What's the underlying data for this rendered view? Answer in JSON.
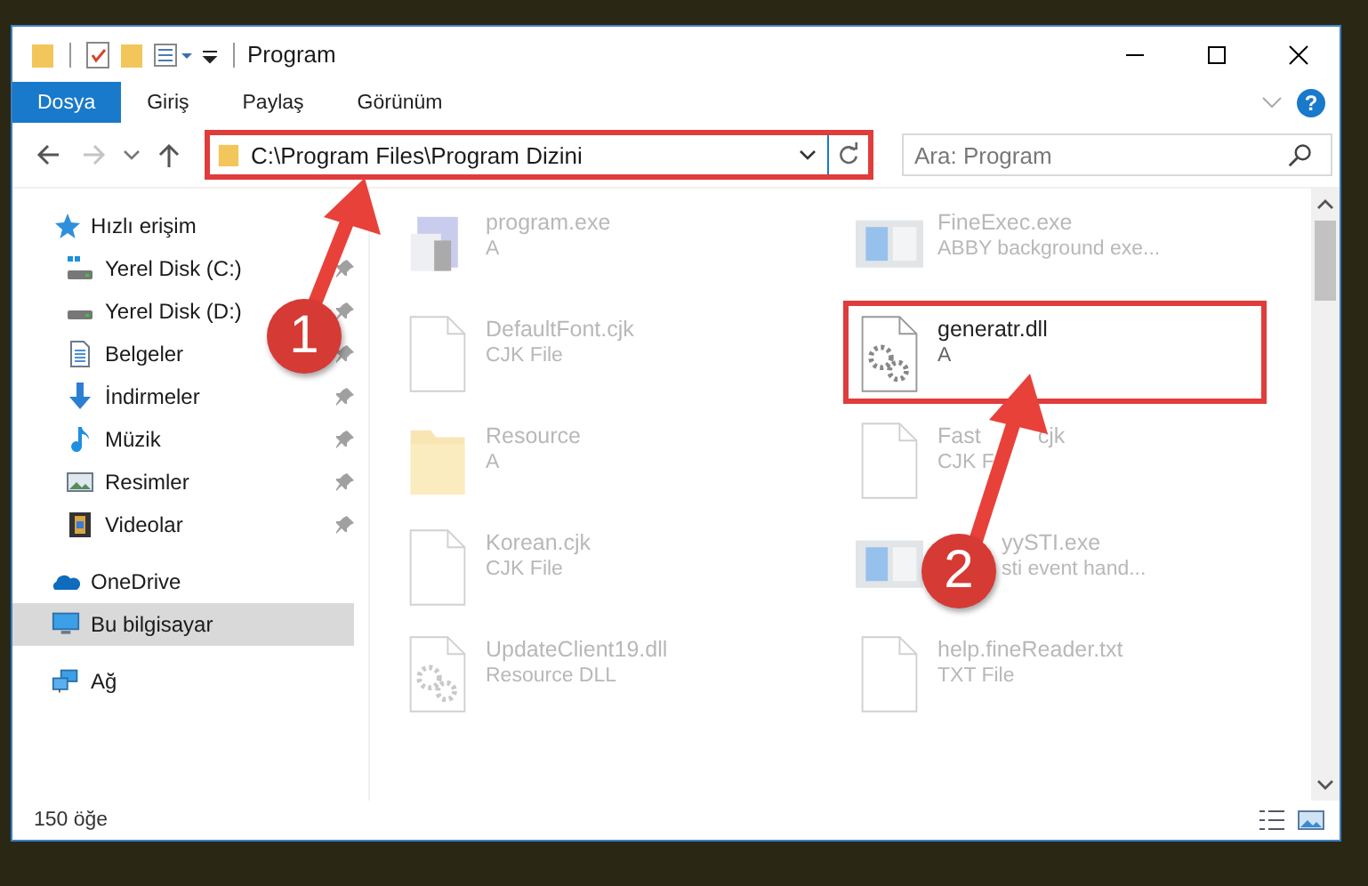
{
  "window": {
    "title": "Program",
    "help": "?"
  },
  "tabs": [
    {
      "label": "Dosya",
      "selected": true
    },
    {
      "label": "Giriş",
      "selected": false
    },
    {
      "label": "Paylaş",
      "selected": false
    },
    {
      "label": "Görünüm",
      "selected": false
    }
  ],
  "navigation": [
    {
      "kind": "back",
      "disabled": false
    },
    {
      "kind": "forward",
      "disabled": true
    }
  ],
  "address": {
    "value": "C:\\Program Files\\Program Dizini",
    "highlighted": true
  },
  "search": {
    "placeholder": "Ara: Program"
  },
  "sidebar": {
    "items": [
      {
        "label": "Hızlı erişim",
        "kind": "star",
        "selected": false,
        "children": [
          {
            "label": "Yerel Disk (C:)",
            "kind": "disk-c",
            "pinned": true,
            "selected": false
          },
          {
            "label": "Yerel Disk (D:)",
            "kind": "disk",
            "pinned": true,
            "selected": false
          },
          {
            "label": "Belgeler",
            "kind": "document",
            "pinned": true,
            "selected": false
          },
          {
            "label": "İndirmeler",
            "kind": "download",
            "pinned": true,
            "selected": false
          },
          {
            "label": "Müzik",
            "kind": "music",
            "pinned": true,
            "selected": false
          },
          {
            "label": "Resimler",
            "kind": "image",
            "pinned": true,
            "selected": false
          },
          {
            "label": "Videolar",
            "kind": "film",
            "pinned": true,
            "selected": false
          }
        ]
      },
      {
        "label": "OneDrive",
        "kind": "cloud",
        "selected": false
      },
      {
        "label": "Bu bilgisayar",
        "kind": "computer",
        "selected": true
      },
      {
        "label": "Ağ",
        "kind": "network",
        "selected": false
      }
    ]
  },
  "files": [
    {
      "name": "program.exe",
      "detail": "A",
      "kind": "exe",
      "blurred": true,
      "highlighted": false
    },
    {
      "name": "FineExec.exe",
      "detail": "ABBY background exe...",
      "kind": "app",
      "blurred": true,
      "highlighted": false
    },
    {
      "name": "DefaultFont.cjk",
      "detail": "CJK File",
      "kind": "file",
      "blurred": true,
      "highlighted": false
    },
    {
      "name": "generatr.dll",
      "detail": "A",
      "kind": "dll",
      "blurred": false,
      "highlighted": true
    },
    {
      "name": "Resource",
      "detail": "A",
      "kind": "folder",
      "blurred": true,
      "highlighted": false
    },
    {
      "name": "Fast",
      "name_tail": "cjk",
      "detail": "CJK F",
      "kind": "file",
      "blurred": true,
      "highlighted": false
    },
    {
      "name": "Korean.cjk",
      "detail": "CJK File",
      "kind": "file",
      "blurred": true,
      "highlighted": false
    },
    {
      "name": "yySTI.exe",
      "detail": "sti event hand...",
      "kind": "app",
      "blurred": true,
      "highlighted": false,
      "covered": true
    },
    {
      "name": "UpdateClient19.dll",
      "detail": "Resource DLL",
      "kind": "dll",
      "blurred": true,
      "highlighted": false
    },
    {
      "name": "help.fineReader.txt",
      "detail": "TXT File",
      "kind": "file",
      "blurred": true,
      "highlighted": false
    }
  ],
  "status_bar": {
    "count": "150 öğe"
  },
  "annotations": [
    {
      "number": "1"
    },
    {
      "number": "2"
    }
  ]
}
